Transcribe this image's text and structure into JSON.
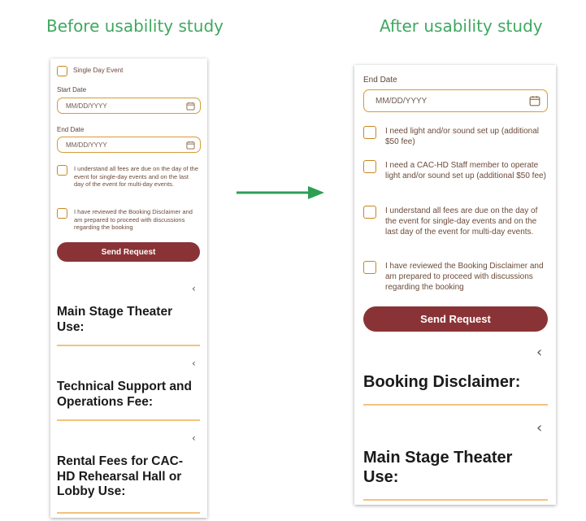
{
  "headings": {
    "before": "Before usability study",
    "after": "After usability study"
  },
  "before": {
    "single_day_label": "Single Day Event",
    "start_date_label": "Start Date",
    "start_date_placeholder": "MM/DD/YYYY",
    "end_date_label": "End Date",
    "end_date_placeholder": "MM/DD/YYYY",
    "fees_agreement": "I understand all fees are due on the day of the event for single-day events and on the last day of the event for multi-day events.",
    "disclaimer_agreement": "I have reviewed the Booking Disclaimer and am prepared to proceed with discussions regarding the booking",
    "send_label": "Send Request",
    "sections": [
      {
        "title": "Main Stage Theater Use:"
      },
      {
        "title": "Technical Support and Operations Fee:"
      },
      {
        "title": "Rental Fees for CAC-HD Rehearsal Hall or Lobby Use:"
      }
    ]
  },
  "after": {
    "end_date_label": "End Date",
    "end_date_placeholder": "MM/DD/YYYY",
    "options": [
      "I need light and/or sound set up (additional $50 fee)",
      "I need a CAC-HD Staff member to operate light and/or sound set up (additional $50 fee)",
      "I understand all fees are due on the day of the event for single-day events and on the last day of the event for multi-day events.",
      "I have reviewed the Booking Disclaimer and am prepared to proceed with discussions regarding the booking"
    ],
    "send_label": "Send Request",
    "sections": [
      {
        "title": "Booking Disclaimer:"
      },
      {
        "title": "Main Stage Theater Use:"
      }
    ]
  },
  "icons": {
    "chevron": "chevron-left-icon",
    "calendar": "calendar-icon",
    "arrow": "right-arrow-icon"
  },
  "colors": {
    "heading": "#3fa860",
    "button": "#8a3336",
    "field_border": "#d79a35",
    "divider": "#f2c27e",
    "arrow": "#2e9e55"
  }
}
